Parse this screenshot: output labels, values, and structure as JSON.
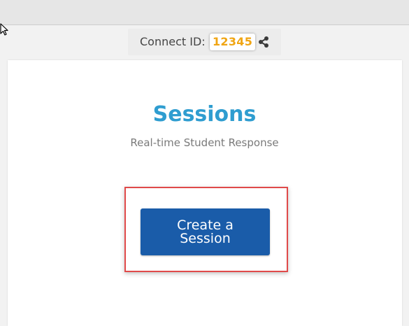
{
  "header": {
    "connect_label": "Connect ID:",
    "connect_id": "12345",
    "share_icon": "share-icon"
  },
  "page": {
    "title": "Sessions",
    "subtitle": "Real-time Student Response"
  },
  "actions": {
    "create_session_label": "Create a Session"
  },
  "colors": {
    "title": "#2f9dd0",
    "button": "#1a5ca9",
    "connect_id": "#f0a513",
    "highlight": "#e04a4a"
  }
}
